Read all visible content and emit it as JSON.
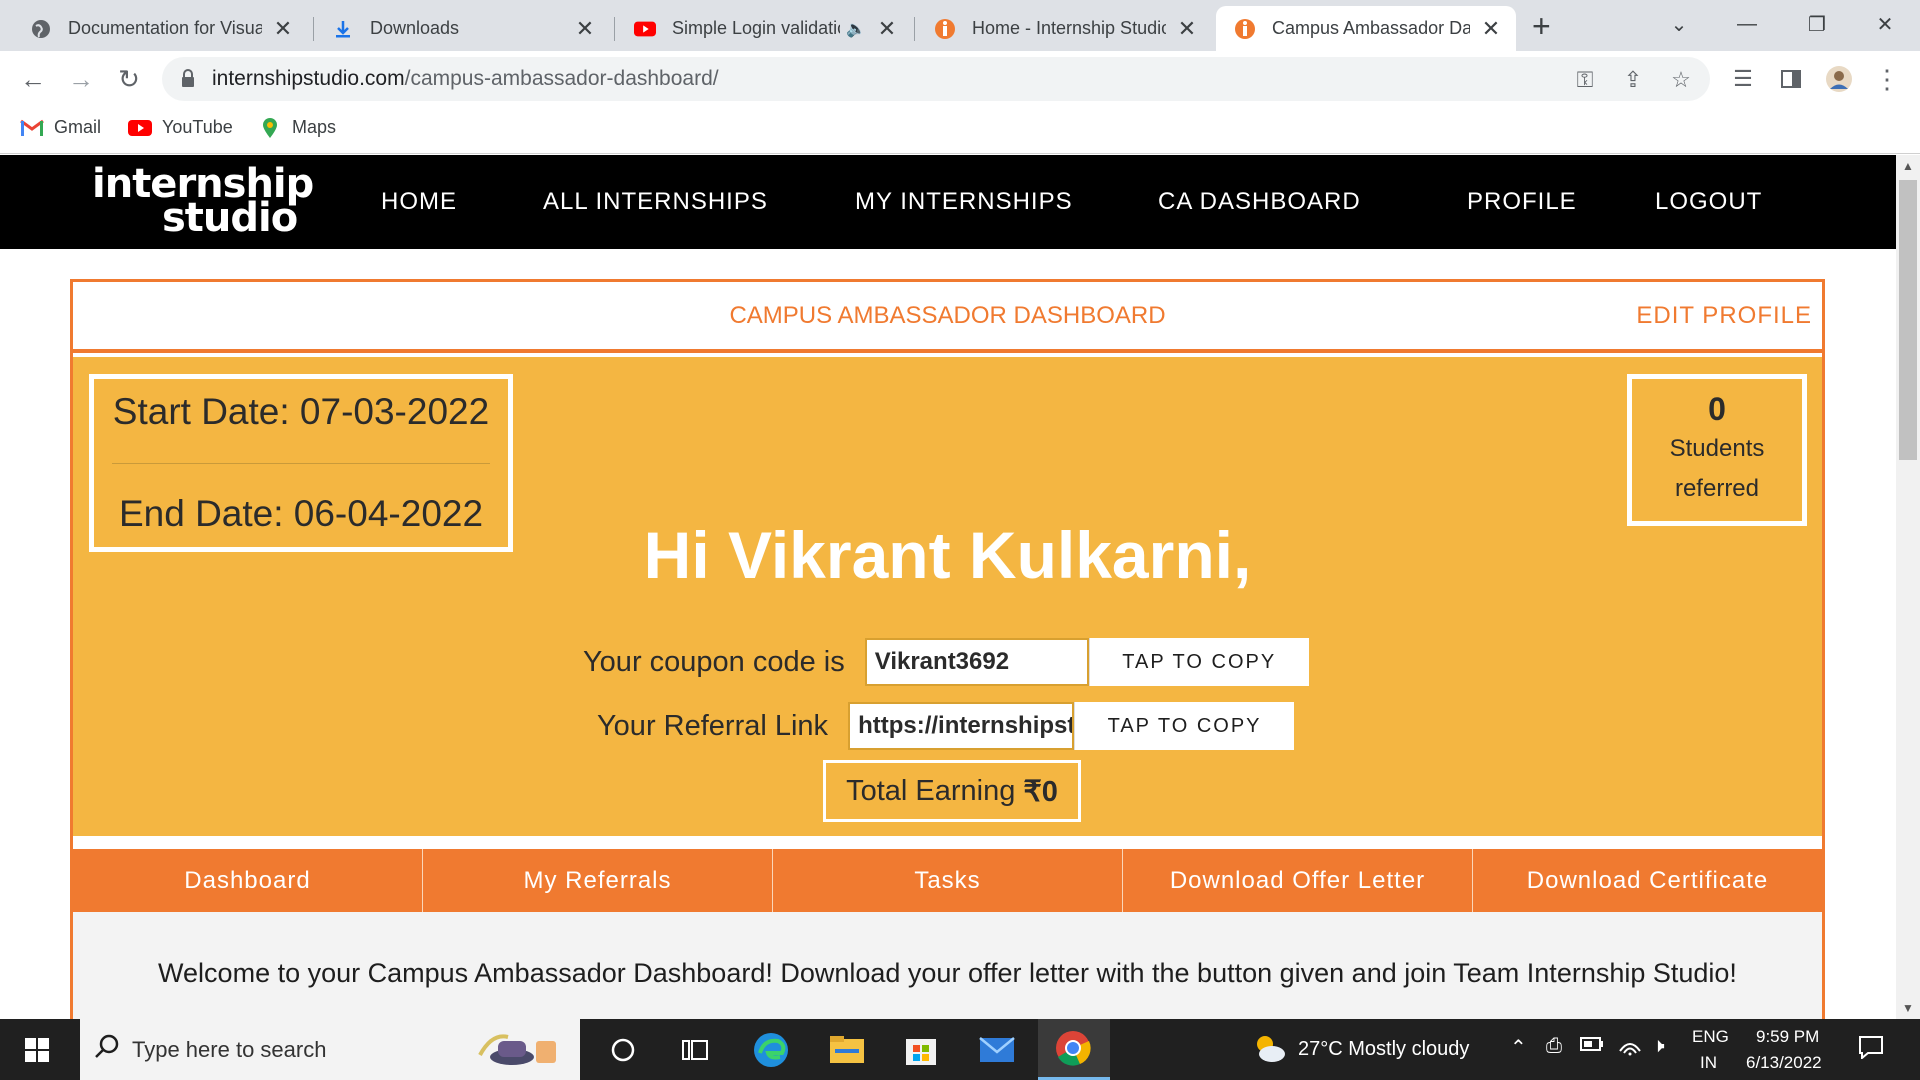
{
  "browser": {
    "tabs": [
      {
        "title": "Documentation for Visual",
        "icon": "globe-icon",
        "active": false
      },
      {
        "title": "Downloads",
        "icon": "download-icon",
        "active": false
      },
      {
        "title": "Simple Login validatio",
        "icon": "youtube-icon",
        "active": false
      },
      {
        "title": "Home - Internship Studio",
        "icon": "internship-studio-icon",
        "active": false
      },
      {
        "title": "Campus Ambassador Das",
        "icon": "internship-studio-icon",
        "active": true
      }
    ],
    "new_tab_label": "+",
    "url_host": "internshipstudio.com",
    "url_path": "/campus-ambassador-dashboard/",
    "bookmarks": [
      {
        "label": "Gmail",
        "icon": "gmail-icon"
      },
      {
        "label": "YouTube",
        "icon": "youtube-icon"
      },
      {
        "label": "Maps",
        "icon": "maps-icon"
      }
    ]
  },
  "site": {
    "logo_line1": "internship",
    "logo_line2": "studio",
    "nav": [
      "HOME",
      "ALL INTERNSHIPS",
      "MY INTERNSHIPS",
      "CA DASHBOARD",
      "PROFILE",
      "LOGOUT"
    ]
  },
  "dashboard": {
    "title": "CAMPUS AMBASSADOR DASHBOARD",
    "edit_profile": "EDIT PROFILE",
    "start_date": "Start Date: 07-03-2022",
    "end_date": "End Date: 06-04-2022",
    "students_count": "0",
    "students_label_1": "Students",
    "students_label_2": "referred",
    "greeting": "Hi Vikrant Kulkarni,",
    "coupon_label": "Your coupon code is",
    "coupon_value": "Vikrant3692",
    "referral_label": "Your Referral Link",
    "referral_value": "https://internshipstudio.com",
    "copy_button": "TAP TO COPY",
    "earning_label": "Total Earning",
    "earning_value": "₹0",
    "subnav": [
      "Dashboard",
      "My Referrals",
      "Tasks",
      "Download Offer Letter",
      "Download Certificate"
    ],
    "welcome": "Welcome to your Campus Ambassador Dashboard! Download your offer letter with the button given and join Team Internship Studio!"
  },
  "taskbar": {
    "search_placeholder": "Type here to search",
    "weather": "27°C  Mostly cloudy",
    "lang_1": "ENG",
    "lang_2": "IN",
    "time": "9:59 PM",
    "date": "6/13/2022"
  },
  "colors": {
    "accent_orange": "#f07a30",
    "banner_yellow": "#f4b642",
    "nav_black": "#000000"
  }
}
